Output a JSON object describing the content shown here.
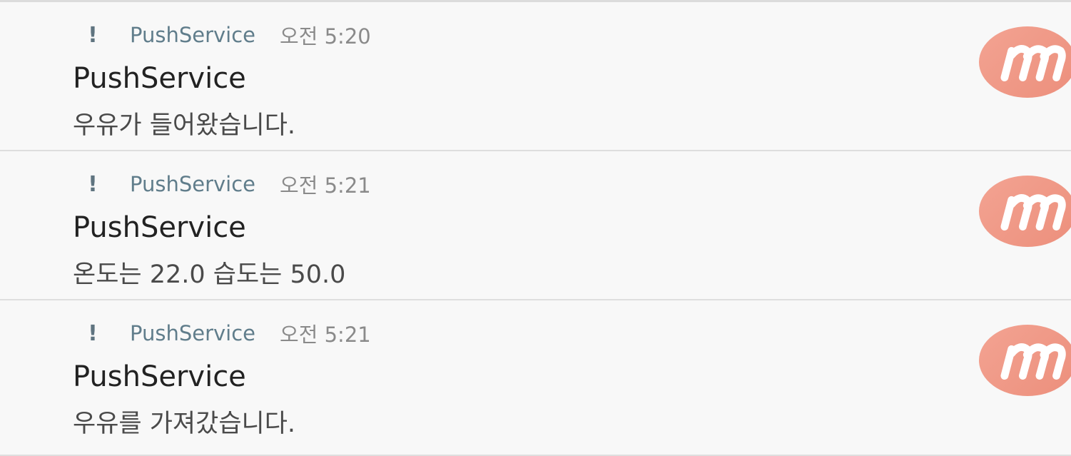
{
  "notifications": [
    {
      "icon": "exclamation-icon",
      "app_name": "PushService",
      "time": "오전 5:20",
      "title": "PushService",
      "body": "우유가 들어왔습니다.",
      "avatar": "m-logo-icon"
    },
    {
      "icon": "exclamation-icon",
      "app_name": "PushService",
      "time": "오전 5:21",
      "title": "PushService",
      "body": "온도는 22.0 습도는 50.0",
      "avatar": "m-logo-icon"
    },
    {
      "icon": "exclamation-icon",
      "app_name": "PushService",
      "time": "오전 5:21",
      "title": "PushService",
      "body": "우유를 가져갔습니다.",
      "avatar": "m-logo-icon"
    }
  ],
  "colors": {
    "app_name": "#607d8b",
    "avatar_bg": "#f0998a",
    "background": "#f8f8f8"
  }
}
